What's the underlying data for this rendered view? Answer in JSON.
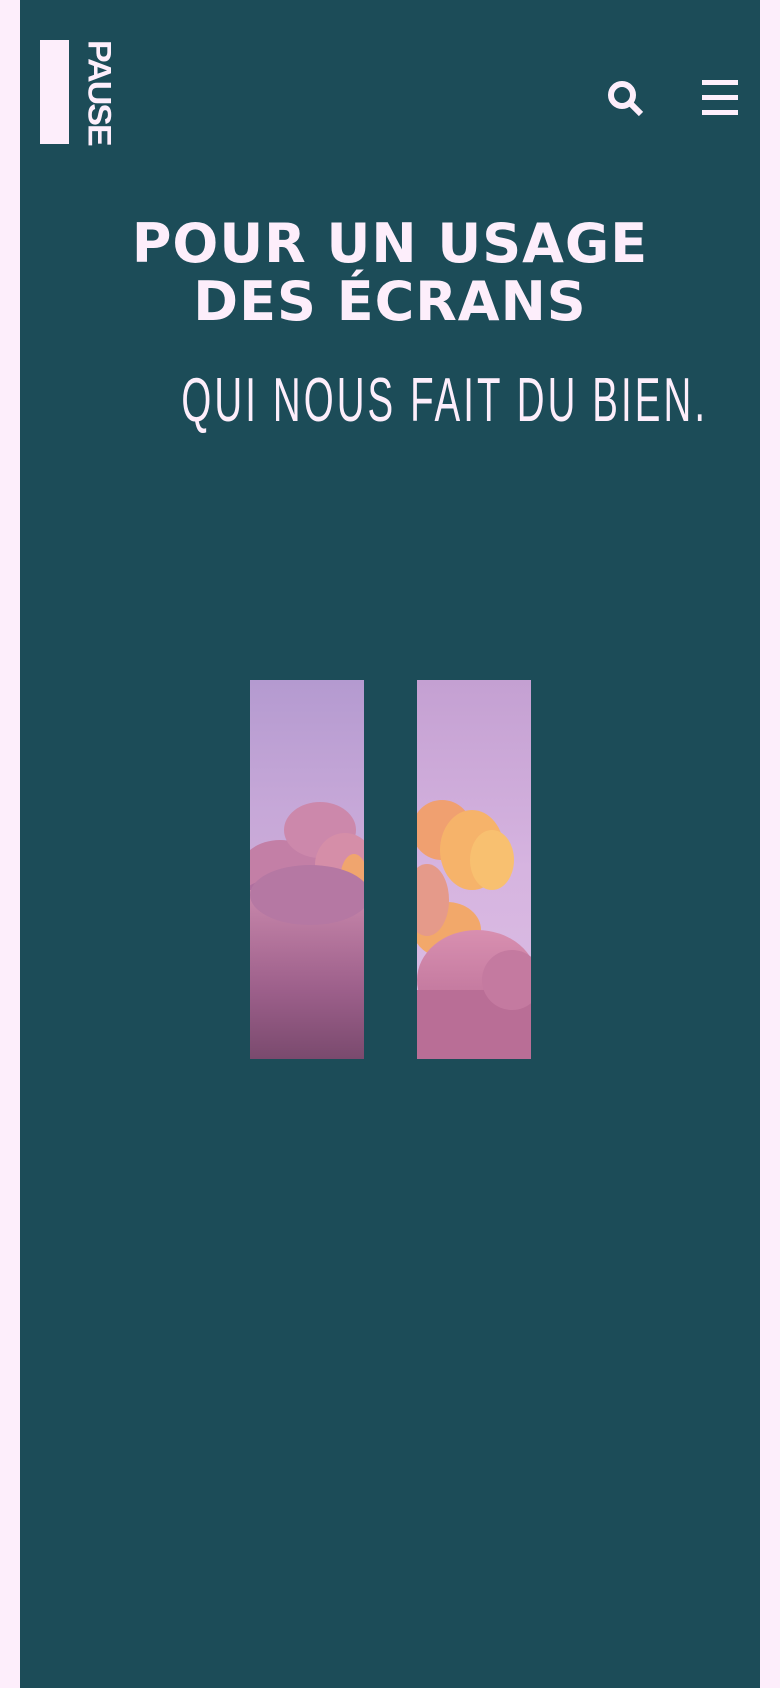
{
  "header": {
    "logo_text": "PAUSE",
    "search_icon": "search-icon",
    "menu_icon": "hamburger-menu-icon"
  },
  "hero": {
    "title_line1": "POUR UN USAGE",
    "title_line2": "DES ÉCRANS",
    "subtitle": "QUI NOUS FAIT DU BIEN."
  },
  "colors": {
    "page_background": "#fdeefb",
    "panel_background": "#1c4c58",
    "text": "#fdeefb",
    "sky_top": "#b49ad0",
    "cloud_pink": "#c47aa8",
    "cloud_orange": "#f2a864"
  }
}
